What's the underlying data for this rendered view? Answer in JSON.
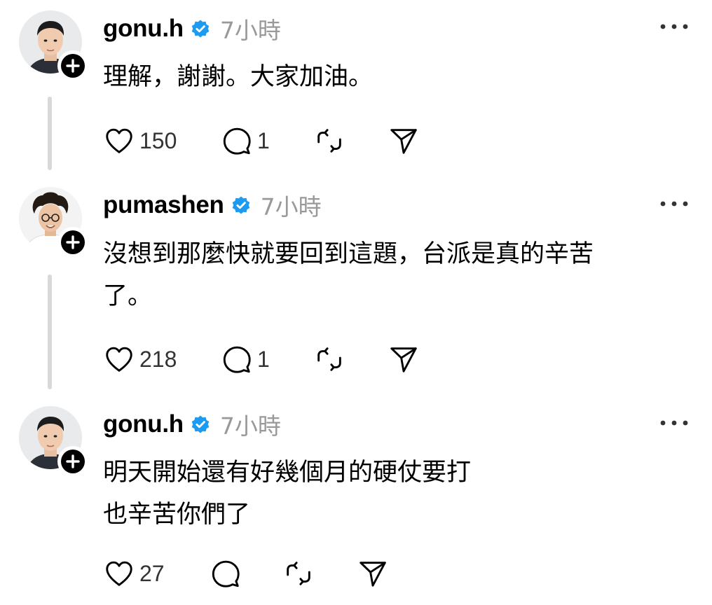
{
  "colors": {
    "background": "#ffffff",
    "text": "#000000",
    "muted": "#999999",
    "verified": "#1d9bf0",
    "thread_line": "#d9d9d9"
  },
  "posts": [
    {
      "username": "gonu.h",
      "verified": true,
      "time": "7小時",
      "lines": [
        "理解，謝謝。大家加油。"
      ],
      "likes": "150",
      "replies": "1",
      "icons": [
        "heart-icon",
        "comment-icon",
        "repost-icon",
        "share-icon",
        "more-icon"
      ]
    },
    {
      "username": "pumashen",
      "verified": true,
      "time": "7小時",
      "lines": [
        "沒想到那麼快就要回到這題，台派是真的辛苦",
        "了。"
      ],
      "likes": "218",
      "replies": "1",
      "icons": [
        "heart-icon",
        "comment-icon",
        "repost-icon",
        "share-icon",
        "more-icon"
      ]
    },
    {
      "username": "gonu.h",
      "verified": true,
      "time": "7小時",
      "lines": [
        "明天開始還有好幾個月的硬仗要打",
        "也辛苦你們了"
      ],
      "likes": "27",
      "replies": "",
      "icons": [
        "heart-icon",
        "comment-icon",
        "repost-icon",
        "share-icon",
        "more-icon"
      ]
    }
  ]
}
